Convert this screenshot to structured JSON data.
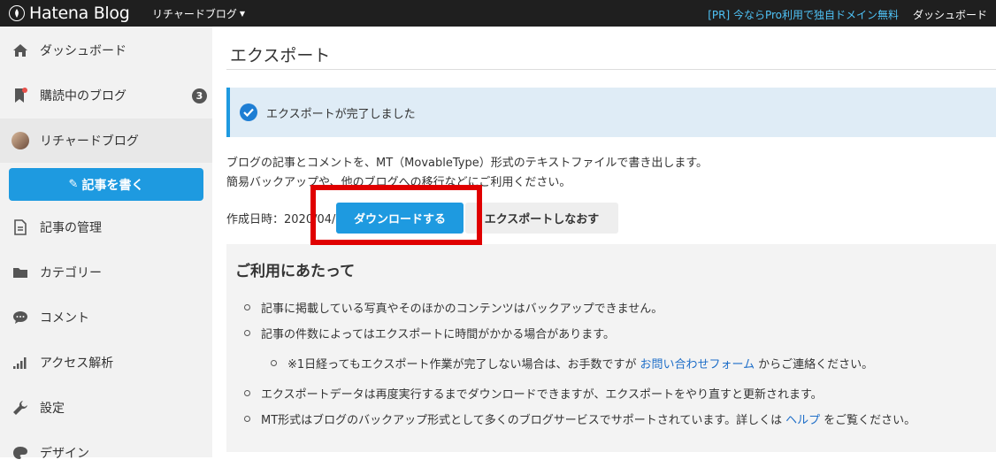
{
  "topbar": {
    "logo_text": "Hatena Blog",
    "blog_name": "リチャードブログ",
    "promo": "[PR] 今ならPro利用で独自ドメイン無料",
    "dashboard": "ダッシュボード"
  },
  "sidebar": {
    "items": [
      {
        "label": "ダッシュボード",
        "icon": "home-icon"
      },
      {
        "label": "購読中のブログ",
        "icon": "bookmark-icon",
        "badge": "3"
      },
      {
        "label": "リチャードブログ",
        "icon": "avatar"
      },
      {
        "label": "記事の管理",
        "icon": "document-icon"
      },
      {
        "label": "カテゴリー",
        "icon": "folder-icon"
      },
      {
        "label": "コメント",
        "icon": "comment-icon"
      },
      {
        "label": "アクセス解析",
        "icon": "chart-bars-icon"
      },
      {
        "label": "設定",
        "icon": "wrench-icon"
      },
      {
        "label": "デザイン",
        "icon": "palette-icon"
      }
    ],
    "write_button": "記事を書く"
  },
  "main": {
    "title": "エクスポート",
    "success_message": "エクスポートが完了しました",
    "description_1": "ブログの記事とコメントを、MT（MovableType）形式のテキストファイルで書き出します。",
    "description_2": "簡易バックアップや、他のブログへの移行などにご利用ください。",
    "created_label": "作成日時：2020/04/1",
    "download_button": "ダウンロードする",
    "reexport_button": "エクスポートしなおす",
    "notes": {
      "title": "ご利用にあたって",
      "item1": "記事に掲載している写真やそのほかのコンテンツはバックアップできません。",
      "item2": "記事の件数によってはエクスポートに時間がかかる場合があります。",
      "item2_sub_before": "※1日経ってもエクスポート作業が完了しない場合は、お手数ですが",
      "item2_sub_link": "お問い合わせフォーム",
      "item2_sub_after": "からご連絡ください。",
      "item3": "エクスポートデータは再度実行するまでダウンロードできますが、エクスポートをやり直すと更新されます。",
      "item4_before": "MT形式はブログのバックアップ形式として多くのブログサービスでサポートされています。詳しくは",
      "item4_link": "ヘルプ",
      "item4_after": "をご覧ください。"
    }
  },
  "colors": {
    "accent": "#1e9ae0",
    "highlight": "#e00000",
    "topbar": "#1f1f1f",
    "link": "#1e6ec8"
  }
}
